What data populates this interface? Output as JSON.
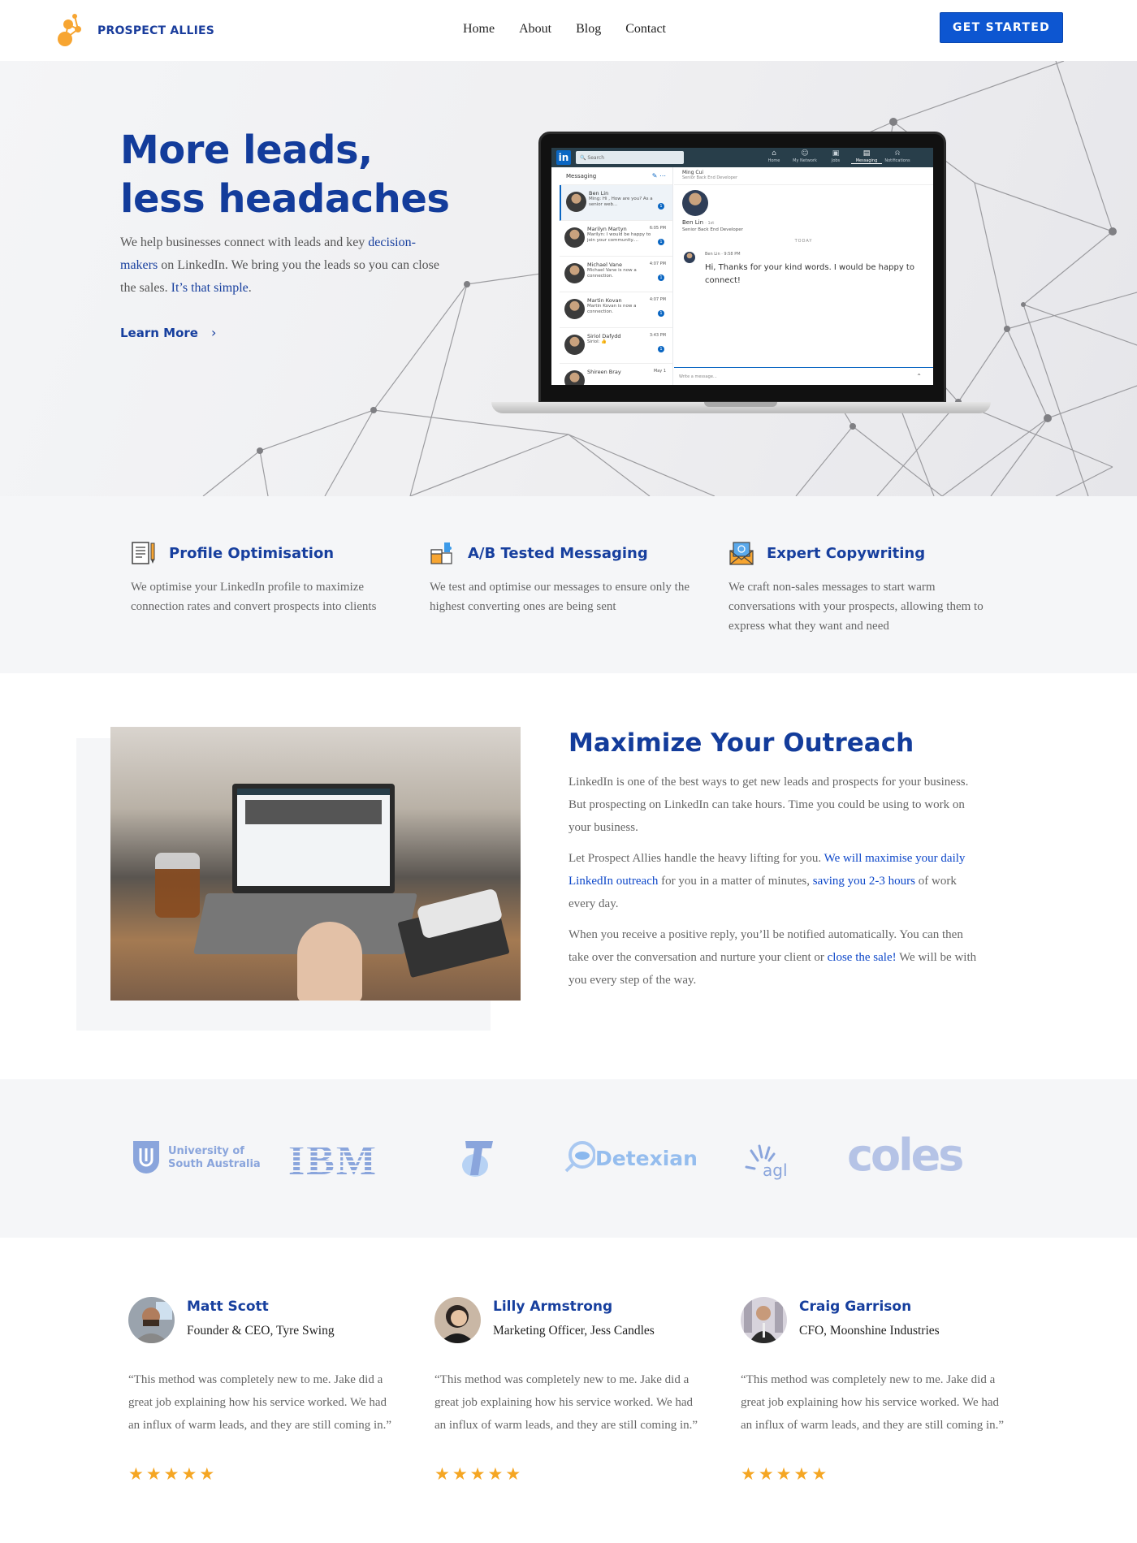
{
  "brand": {
    "name": "PROSPECT ALLIES",
    "accent": "#133c9b",
    "button": "#0d56d1",
    "logo_color": "#f7a531",
    "star_color": "#f5a623"
  },
  "nav": {
    "items": [
      "Home",
      "About",
      "Blog",
      "Contact"
    ],
    "cta": "GET STARTED"
  },
  "hero": {
    "title_line1": "More leads,",
    "title_line2": "less headaches",
    "text_1": "We help businesses connect with leads and key ",
    "text_link_1": "decision-makers",
    "text_2": " on LinkedIn. We bring you the leads so you can close the sales. ",
    "text_link_2": "It’s that simple",
    "text_3": ".",
    "learn_more": "Learn More",
    "learn_more_icon": "chevron-right-icon"
  },
  "laptop_screen": {
    "search_placeholder": "Search",
    "nav": [
      "Home",
      "My Network",
      "Jobs",
      "Messaging",
      "Notifications"
    ],
    "active_nav": "Messaging",
    "messaging_label": "Messaging",
    "conversations": [
      {
        "name": "Ben Lin",
        "preview": "Ming: Hi , How are you? As a senior web...",
        "time": "",
        "badge": "1"
      },
      {
        "name": "Marilyn Martyn",
        "preview": "Marilyn: I would be happy to join your community....",
        "time": "6:05 PM",
        "badge": "1"
      },
      {
        "name": "Michael Vane",
        "preview": "Michael Vane is now a connection.",
        "time": "4:07 PM",
        "badge": "1"
      },
      {
        "name": "Martin Kovan",
        "preview": "Martin Kovan is now a connection.",
        "time": "4:07 PM",
        "badge": "1"
      },
      {
        "name": "Siriol Dafydd",
        "preview": "Siriol: 👍",
        "time": "3:43 PM",
        "badge": "1"
      },
      {
        "name": "Shireen Bray",
        "preview": "",
        "time": "May 1",
        "badge": ""
      }
    ],
    "chat_header_name": "Ming Cui",
    "chat_header_role": "Senior Back End Developer",
    "profile_name": "Ben Lin",
    "profile_degree": "· 1st",
    "profile_role": "Senior Back End Developer",
    "divider": "TODAY",
    "message_sender": "Ben Lin",
    "message_time": "· 9:58 PM",
    "message_text": "Hi, Thanks for your kind words. I would be happy to connect!",
    "input_placeholder": "Write a message..."
  },
  "features": [
    {
      "icon": "document-pencil-icon",
      "title": "Profile Optimisation",
      "text": "We optimise your LinkedIn profile to maximize connection rates and convert prospects into clients"
    },
    {
      "icon": "puzzle-icon",
      "title": "A/B Tested Messaging",
      "text": "We test and optimise our messages to ensure only the highest converting ones are being sent"
    },
    {
      "icon": "email-envelope-icon",
      "title": "Expert Copywriting",
      "text": "We craft non-sales messages to start warm conversations with your prospects, allowing them to express what they want and need"
    }
  ],
  "outreach": {
    "title": "Maximize Your Outreach",
    "p1": "LinkedIn is one of the best ways to get new leads and prospects for your business. But prospecting on LinkedIn can take hours. Time you could be using to work on your business.",
    "p2_a": "Let Prospect Allies handle the heavy lifting for you. ",
    "p2_link1": "We will maximise your daily LinkedIn outreach",
    "p2_b": " for you in a matter of minutes, ",
    "p2_link2": "saving you 2-3 hours",
    "p2_c": " of work every day.",
    "p3_a": "When you receive a positive reply, you’ll be notified automatically. You can then take over the conversation and nurture your client or ",
    "p3_link": "close the sale!",
    "p3_b": " We will be with you every step of the way."
  },
  "client_logos": [
    {
      "name": "University of South Australia",
      "line1": "University of",
      "line2": "South Australia"
    },
    {
      "name": "IBM",
      "text": "IBM"
    },
    {
      "name": "Telstra",
      "text": "T"
    },
    {
      "name": "Detexian",
      "text": "Detexian"
    },
    {
      "name": "AGL",
      "text": "agl"
    },
    {
      "name": "Coles",
      "text": "coles"
    }
  ],
  "testimonials": [
    {
      "name": "Matt Scott",
      "role": "Founder & CEO, Tyre Swing",
      "quote": "“This method was completely new to me. Jake did a great job explaining how his service worked. We had an influx of warm leads, and they are still coming in.”",
      "rating": 5
    },
    {
      "name": "Lilly Armstrong",
      "role": "Marketing Officer, Jess Candles",
      "quote": "“This method was completely new to me. Jake did a great job explaining how his service worked. We had an influx of warm leads, and they are still coming in.”",
      "rating": 5
    },
    {
      "name": "Craig Garrison",
      "role": "CFO, Moonshine Industries",
      "quote": "“This method was completely new to me. Jake did a great job explaining how his service worked. We had an influx of warm leads, and they are still coming in.”",
      "rating": 5
    }
  ]
}
